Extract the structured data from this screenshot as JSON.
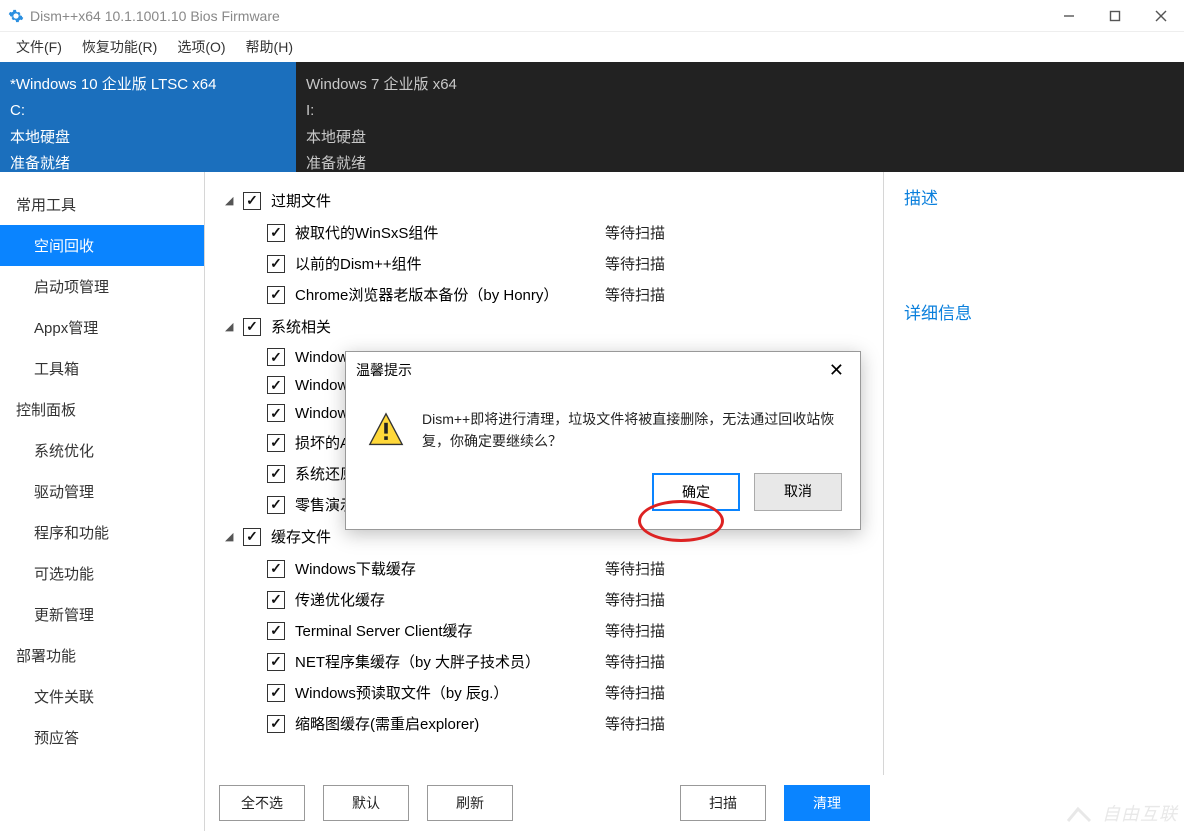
{
  "window": {
    "title": "Dism++x64 10.1.1001.10 Bios Firmware"
  },
  "menu": [
    "文件(F)",
    "恢复功能(R)",
    "选项(O)",
    "帮助(H)"
  ],
  "ostabs": [
    {
      "name": "*Windows 10 企业版 LTSC x64",
      "drive": "C:",
      "disk": "本地硬盘",
      "status": "准备就绪",
      "active": true
    },
    {
      "name": "Windows 7 企业版 x64",
      "drive": "I:",
      "disk": "本地硬盘",
      "status": "准备就绪",
      "active": false
    }
  ],
  "sidebar": [
    {
      "head": "常用工具"
    },
    {
      "item": "空间回收",
      "active": true
    },
    {
      "item": "启动项管理"
    },
    {
      "item": "Appx管理"
    },
    {
      "item": "工具箱"
    },
    {
      "head": "控制面板"
    },
    {
      "item": "系统优化"
    },
    {
      "item": "驱动管理"
    },
    {
      "item": "程序和功能"
    },
    {
      "item": "可选功能"
    },
    {
      "item": "更新管理"
    },
    {
      "head": "部署功能"
    },
    {
      "item": "文件关联"
    },
    {
      "item": "预应答"
    }
  ],
  "tree": [
    {
      "group": "过期文件",
      "children": [
        {
          "label": "被取代的WinSxS组件",
          "status": "等待扫描"
        },
        {
          "label": "以前的Dism++组件",
          "status": "等待扫描"
        },
        {
          "label": "Chrome浏览器老版本备份（by Honry）",
          "status": "等待扫描"
        }
      ]
    },
    {
      "group": "系统相关",
      "children": [
        {
          "label": "Windows",
          "status": ""
        },
        {
          "label": "Windows",
          "status": ""
        },
        {
          "label": "Windows",
          "status": ""
        },
        {
          "label": "损坏的A",
          "status": ""
        },
        {
          "label": "系统还原",
          "status": ""
        },
        {
          "label": "零售演示",
          "status": ""
        }
      ]
    },
    {
      "group": "缓存文件",
      "children": [
        {
          "label": "Windows下载缓存",
          "status": "等待扫描"
        },
        {
          "label": "传递优化缓存",
          "status": "等待扫描"
        },
        {
          "label": "Terminal Server Client缓存",
          "status": "等待扫描"
        },
        {
          "label": "NET程序集缓存（by 大胖子技术员）",
          "status": "等待扫描"
        },
        {
          "label": "Windows预读取文件（by 辰g.）",
          "status": "等待扫描"
        },
        {
          "label": "缩略图缓存(需重启explorer)",
          "status": "等待扫描"
        }
      ]
    }
  ],
  "buttons": {
    "deselectAll": "全不选",
    "default": "默认",
    "refresh": "刷新",
    "scan": "扫描",
    "clean": "清理"
  },
  "rightpanel": {
    "desc": "描述",
    "detail": "详细信息"
  },
  "dialog": {
    "title": "温馨提示",
    "message": "Dism++即将进行清理，垃圾文件将被直接删除，无法通过回收站恢复，你确定要继续么？",
    "ok": "确定",
    "cancel": "取消"
  },
  "watermark": "自由互联"
}
